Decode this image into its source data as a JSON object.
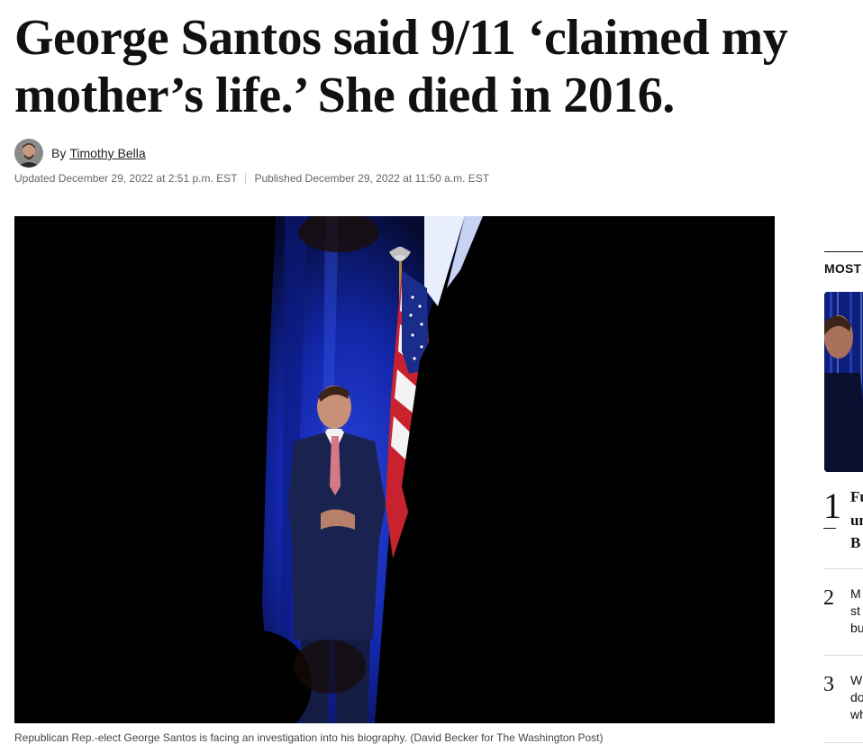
{
  "article": {
    "headline": "George Santos said 9/11 ‘claimed my mother’s life.’ She died in 2016.",
    "byline_prefix": "By",
    "author": "Timothy Bella",
    "updated": "Updated December 29, 2022 at 2:51 p.m. EST",
    "published": "Published December 29, 2022 at 11:50 a.m. EST",
    "caption": "Republican Rep.-elect George Santos is facing an investigation into his biography. (David Becker for The Washington Post)"
  },
  "rail": {
    "heading": "MOST",
    "items": [
      {
        "number": "1",
        "lines": [
          "Fu",
          "un",
          "B"
        ]
      },
      {
        "number": "2",
        "lines": [
          "M",
          "st",
          "bu"
        ]
      },
      {
        "number": "3",
        "lines": [
          "Wl",
          "do",
          "wh"
        ]
      }
    ]
  },
  "colors": {
    "text": "#111111",
    "meta": "#666666",
    "stage_blue": "#1630b8",
    "flag_red": "#c8222e"
  },
  "icons": {
    "avatar": "author-avatar"
  }
}
